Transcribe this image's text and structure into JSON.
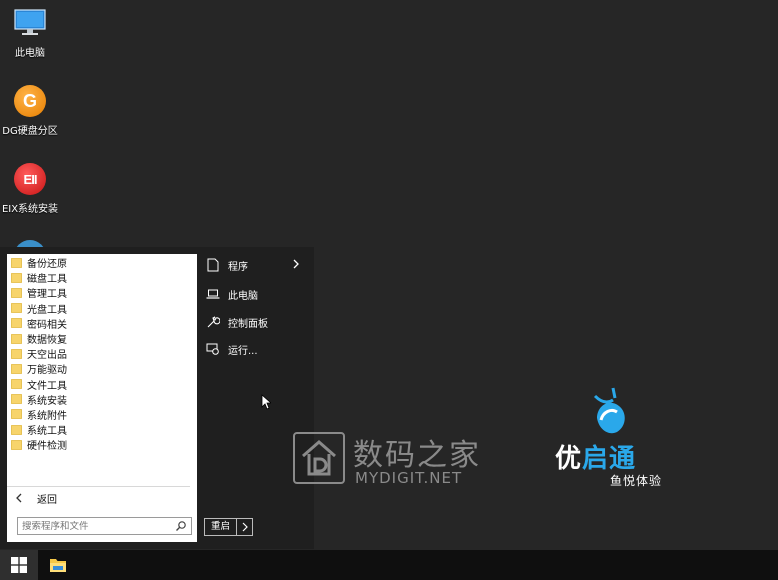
{
  "desktop": {
    "icons": [
      {
        "label": "此电脑",
        "icon": "monitor-icon"
      },
      {
        "label": "DG硬盘分区",
        "icon": "dg-icon",
        "glyph": "G"
      },
      {
        "label": "EIX系统安装",
        "icon": "eix-icon",
        "glyph": "EII"
      }
    ]
  },
  "start_menu": {
    "programs": [
      "备份还原",
      "磁盘工具",
      "管理工具",
      "光盘工具",
      "密码相关",
      "数据恢复",
      "天空出品",
      "万能驱动",
      "文件工具",
      "系统安装",
      "系统附件",
      "系统工具",
      "硬件检测"
    ],
    "back_label": "返回",
    "search_placeholder": "搜索程序和文件",
    "right_items": {
      "programs": "程序",
      "computer": "此电脑",
      "control_panel": "控制面板",
      "run": "运行..."
    },
    "restart_label": "重启"
  },
  "watermark": {
    "cn": "数码之家",
    "en": "MYDIGIT.NET"
  },
  "logo": {
    "title_part1": "优",
    "title_part2": "启通",
    "subtitle": "鱼悦体验"
  },
  "colors": {
    "desktop_bg": "#262626",
    "menu_bg": "#1f1f1f",
    "accent_blue": "#2aa8ea",
    "folder_yellow": "#f7d46b"
  }
}
